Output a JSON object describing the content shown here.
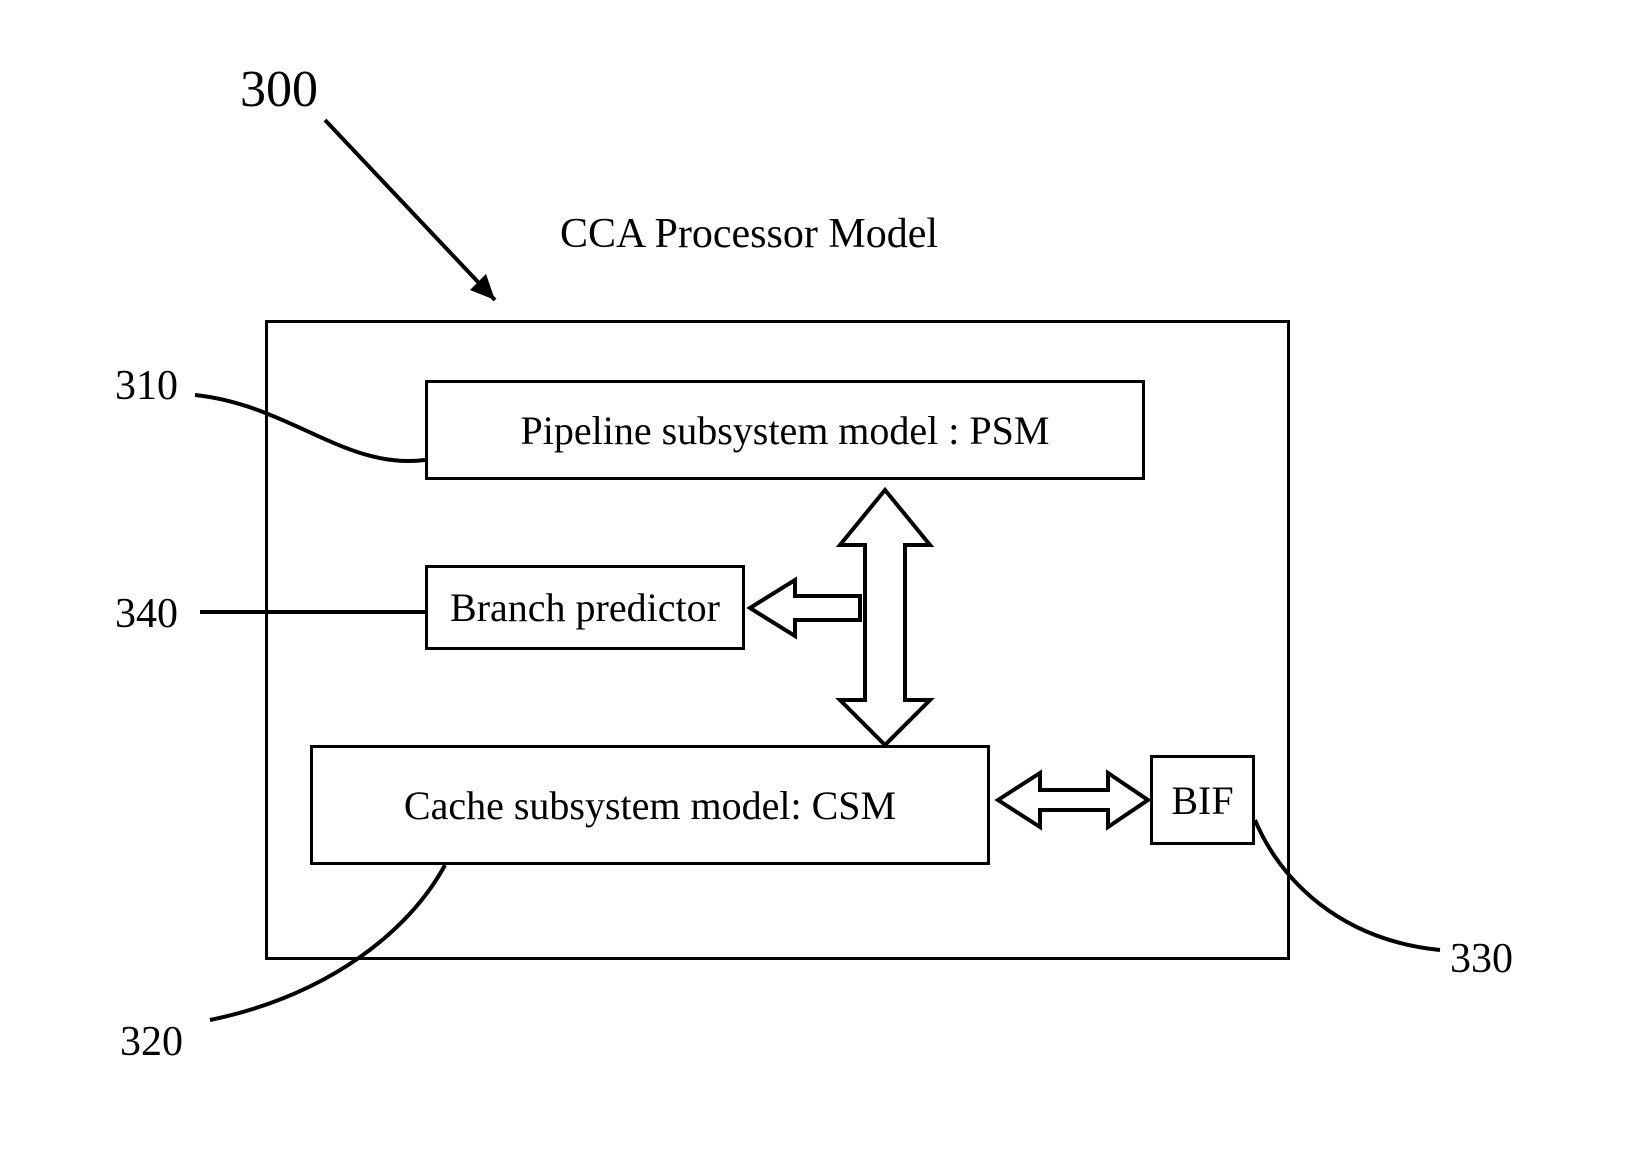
{
  "title": "CCA Processor Model",
  "refs": {
    "main": "300",
    "psm": "310",
    "csm": "320",
    "bif": "330",
    "branch": "340"
  },
  "blocks": {
    "psm": "Pipeline subsystem model : PSM",
    "branch": "Branch predictor",
    "csm": "Cache subsystem model: CSM",
    "bif": "BIF"
  }
}
